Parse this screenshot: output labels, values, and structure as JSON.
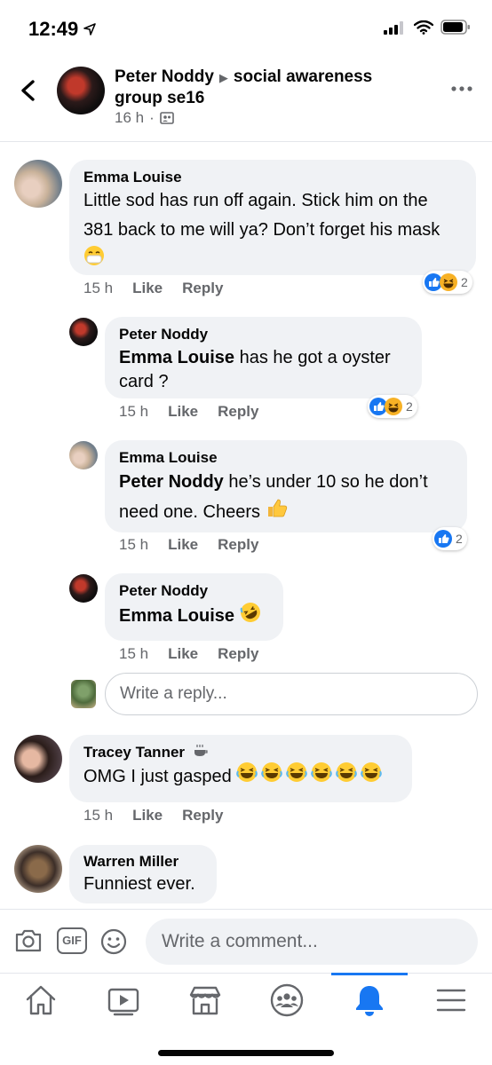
{
  "status_bar": {
    "time": "12:49"
  },
  "header": {
    "author": "Peter Noddy",
    "group": "social awareness group se16",
    "time": "16 h",
    "dot": "·"
  },
  "comments": [
    {
      "name": "Emma Louise",
      "text": "Little sod has run off again. Stick him on the 381 back to me will ya? Don’t forget his mask",
      "time": "15 h",
      "like": "Like",
      "reply": "Reply",
      "reaction_count": "2"
    },
    {
      "name": "Peter Noddy",
      "mention": "Emma Louise",
      "text": "has he got a oyster card ?",
      "time": "15 h",
      "like": "Like",
      "reply": "Reply",
      "reaction_count": "2"
    },
    {
      "name": "Emma Louise",
      "mention": "Peter Noddy",
      "text": "he’s under 10 so he don’t need one. Cheers",
      "time": "15 h",
      "like": "Like",
      "reply": "Reply",
      "reaction_count": "2"
    },
    {
      "name": "Peter Noddy",
      "mention": "Emma Louise",
      "text": "",
      "time": "15 h",
      "like": "Like",
      "reply": "Reply"
    },
    {
      "name": "Tracey Tanner",
      "text": "OMG I just gasped",
      "time": "15 h",
      "like": "Like",
      "reply": "Reply"
    },
    {
      "name": "Warren Miller",
      "text": "Funniest ever."
    }
  ],
  "reply_input": {
    "placeholder": "Write a reply..."
  },
  "composer": {
    "placeholder": "Write a comment...",
    "gif_label": "GIF"
  },
  "tabs": [
    "home",
    "watch",
    "marketplace",
    "groups",
    "notifications",
    "menu"
  ],
  "colors": {
    "accent": "#1877f2",
    "bubble": "#f0f2f5",
    "secondary_text": "#65676b"
  }
}
